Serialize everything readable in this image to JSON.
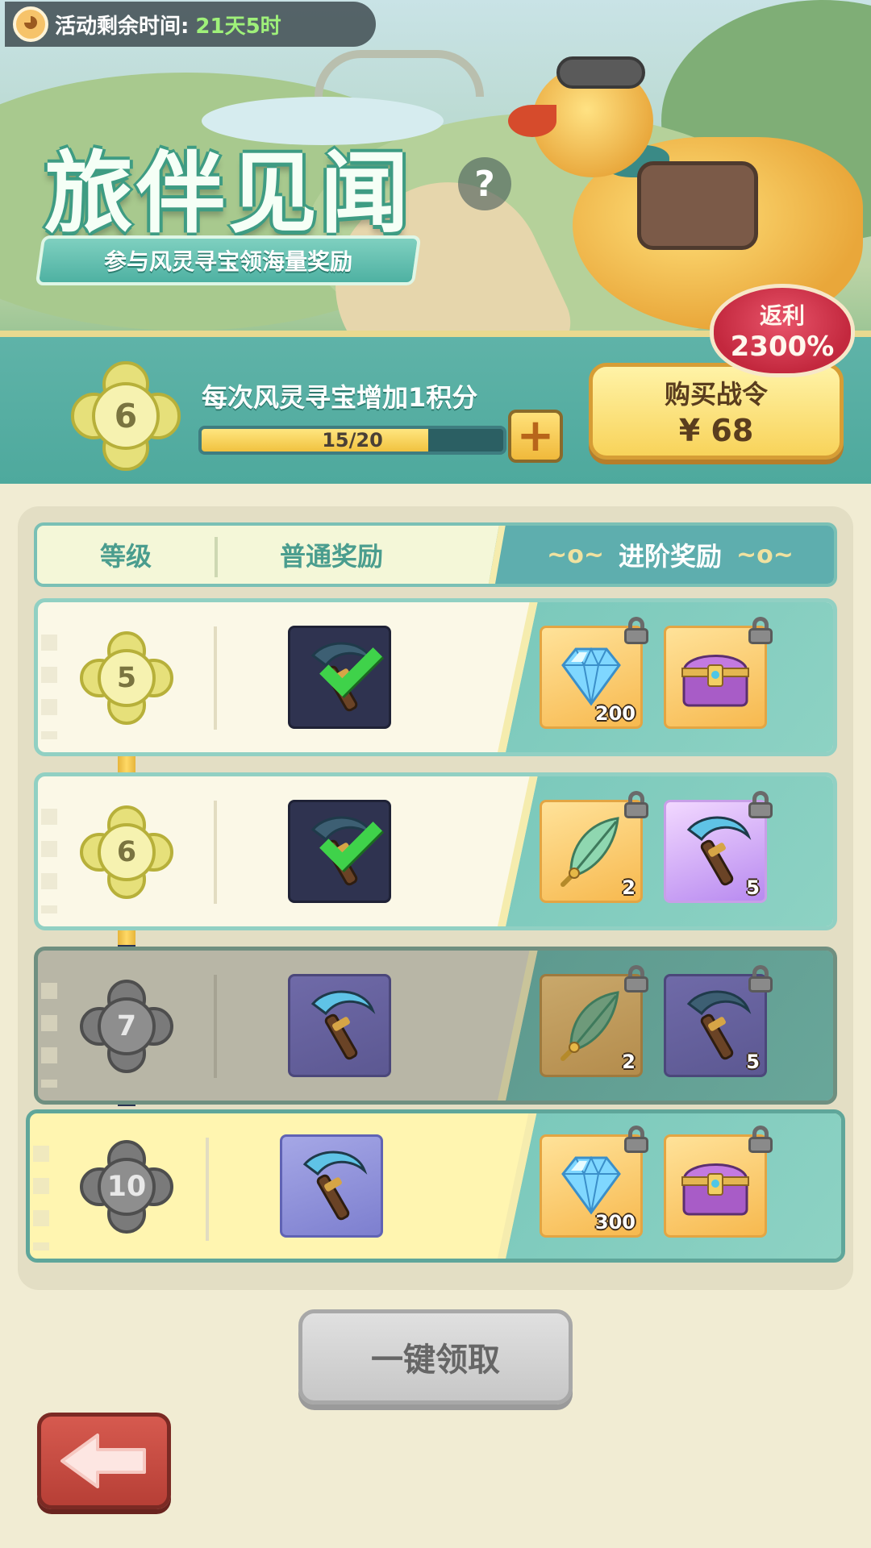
{
  "header": {
    "timer_label": "活动剩余时间:",
    "timer_value": "21天5时",
    "title": "旅伴见闻",
    "help": "?",
    "subtitle": "参与风灵寻宝领海量奖励",
    "rebate_label": "返利",
    "rebate_value": "2300%"
  },
  "progress": {
    "level": "6",
    "description": "每次风灵寻宝增加1积分",
    "current": 15,
    "max": 20,
    "text": "15/20",
    "fraction": 0.75,
    "plus": "+"
  },
  "buy": {
    "label": "购买战令",
    "price": "¥  68"
  },
  "table": {
    "columns": [
      "等级",
      "普通奖励",
      "进阶奖励"
    ],
    "rows": [
      {
        "level": "5",
        "state": "claimed",
        "normal": {
          "icon": "scythe-icon",
          "claimed": true
        },
        "advanced": [
          {
            "icon": "diamond-icon",
            "qty": "200",
            "locked": true
          },
          {
            "icon": "chest-icon",
            "qty": "",
            "locked": true
          }
        ]
      },
      {
        "level": "6",
        "state": "claimed",
        "normal": {
          "icon": "scythe-icon",
          "claimed": true
        },
        "advanced": [
          {
            "icon": "feather-icon",
            "qty": "2",
            "locked": true
          },
          {
            "icon": "scythe-icon",
            "qty": "5",
            "locked": true
          }
        ]
      },
      {
        "level": "7",
        "state": "locked",
        "normal": {
          "icon": "scythe-icon",
          "claimed": false
        },
        "advanced": [
          {
            "icon": "feather-icon",
            "qty": "2",
            "locked": true
          },
          {
            "icon": "scythe-icon",
            "qty": "5",
            "locked": true
          }
        ]
      },
      {
        "level": "10",
        "state": "milestone",
        "normal": {
          "icon": "scythe-icon",
          "claimed": false
        },
        "advanced": [
          {
            "icon": "diamond-icon",
            "qty": "300",
            "locked": true
          },
          {
            "icon": "chest-icon",
            "qty": "",
            "locked": true
          }
        ]
      }
    ]
  },
  "claim_all": "一键领取",
  "back_icon": "back-arrow-icon"
}
